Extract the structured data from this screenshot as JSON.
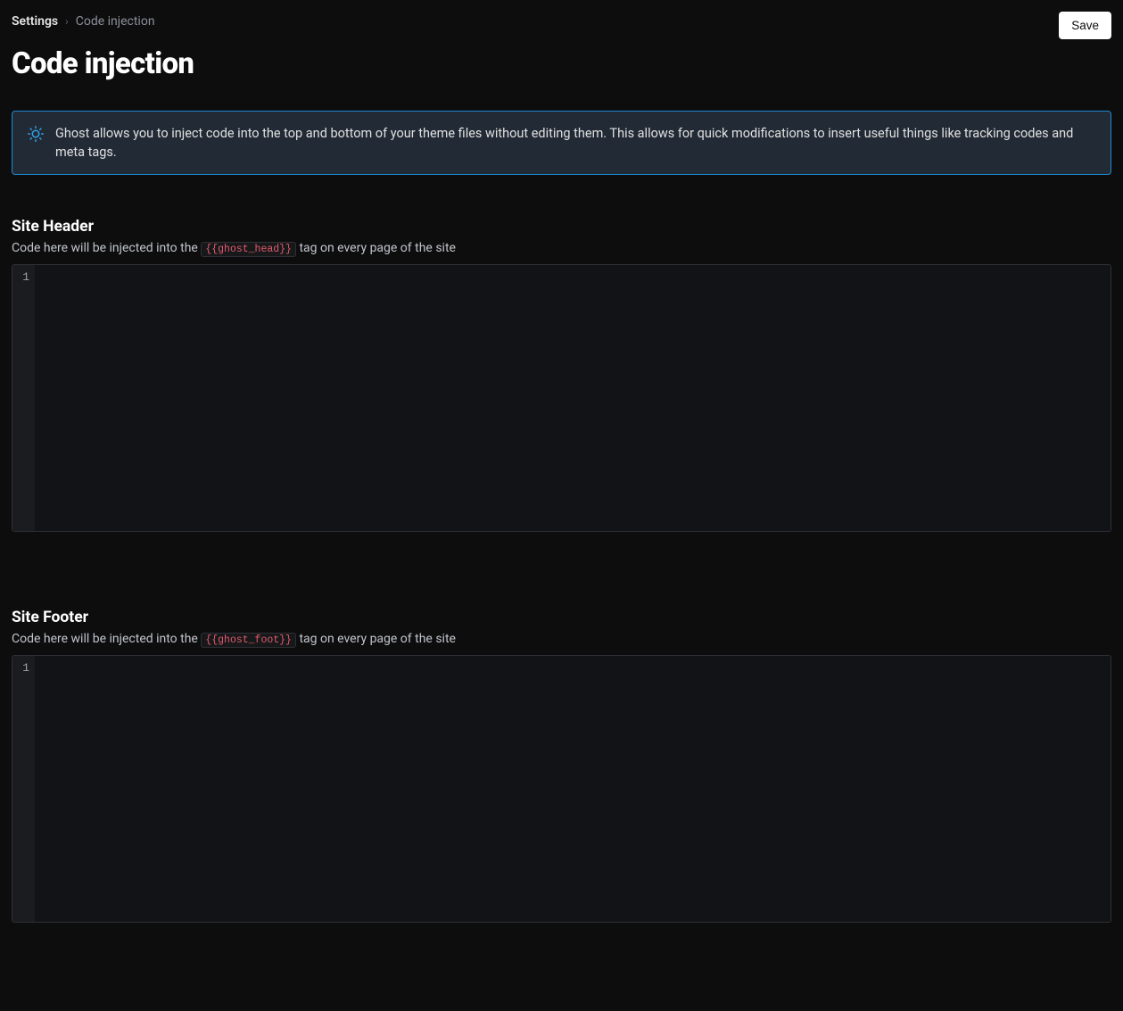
{
  "breadcrumb": {
    "parent": "Settings",
    "current": "Code injection"
  },
  "header": {
    "title": "Code injection",
    "save_label": "Save"
  },
  "banner": {
    "text": "Ghost allows you to inject code into the top and bottom of your theme files without editing them. This allows for quick modifications to insert useful things like tracking codes and meta tags."
  },
  "sections": {
    "header": {
      "title": "Site Header",
      "desc_prefix": "Code here will be injected into the ",
      "code_tag": "{{ghost_head}}",
      "desc_suffix": " tag on every page of the site",
      "gutter_line": "1",
      "content": ""
    },
    "footer": {
      "title": "Site Footer",
      "desc_prefix": "Code here will be injected into the ",
      "code_tag": "{{ghost_foot}}",
      "desc_suffix": " tag on every page of the site",
      "gutter_line": "1",
      "content": ""
    }
  }
}
